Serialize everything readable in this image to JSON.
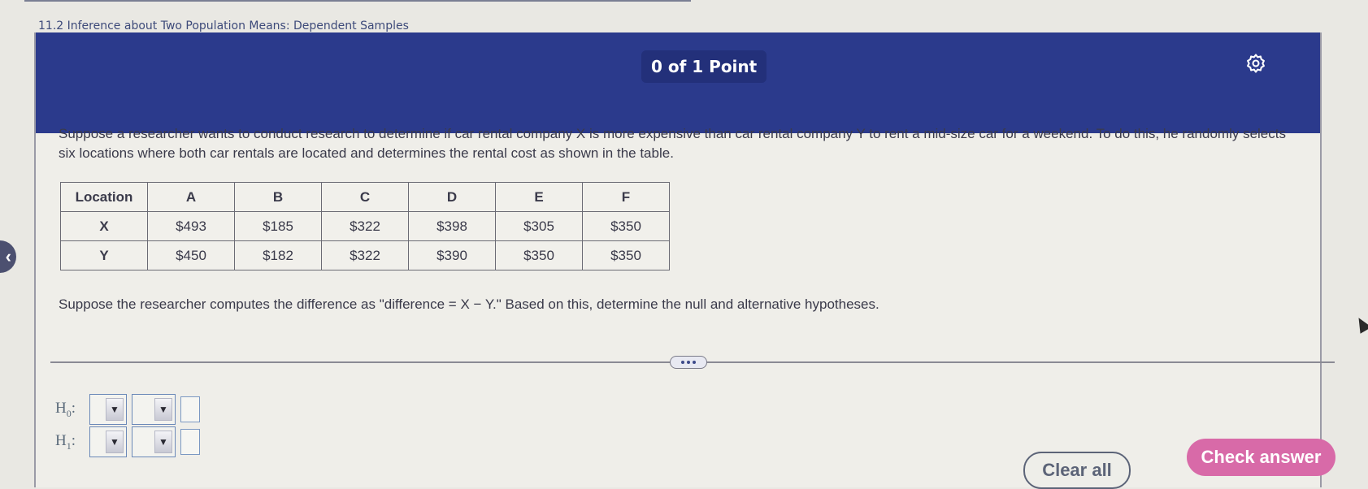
{
  "section_title": "11.2 Inference about Two Population Means: Dependent Samples",
  "header": {
    "points": "0 of 1 Point",
    "settings_icon": "gear-icon",
    "accent_color": "#2b3a8c"
  },
  "question": {
    "text": "Suppose a researcher wants to conduct research to determine if car rental company X is more expensive than car rental company Y to rent a mid-size car for a weekend. To do this, he randomly selects six locations where both car rentals are located and determines the rental cost as shown in the table.",
    "followup": "Suppose the researcher computes the difference as \"difference = X − Y.\" Based on this, determine the null and alternative hypotheses."
  },
  "table": {
    "headers": [
      "Location",
      "A",
      "B",
      "C",
      "D",
      "E",
      "F"
    ],
    "rows": [
      {
        "label": "X",
        "values": [
          "$493",
          "$185",
          "$322",
          "$398",
          "$305",
          "$350"
        ]
      },
      {
        "label": "Y",
        "values": [
          "$450",
          "$182",
          "$322",
          "$390",
          "$350",
          "$350"
        ]
      }
    ]
  },
  "more_button_icon": "ellipsis-icon",
  "hypotheses": [
    {
      "label": "H",
      "sub": "0",
      "dropdown1": "",
      "dropdown2": "",
      "value": ""
    },
    {
      "label": "H",
      "sub": "1",
      "dropdown1": "",
      "dropdown2": "",
      "value": ""
    }
  ],
  "dropdown_arrow": "▼",
  "buttons": {
    "clear_all": "Clear all",
    "check_answer": "Check answer",
    "check_color": "#d86aa8"
  },
  "side_nav_icon": "chevron-left-icon",
  "side_nav_glyph": "‹"
}
